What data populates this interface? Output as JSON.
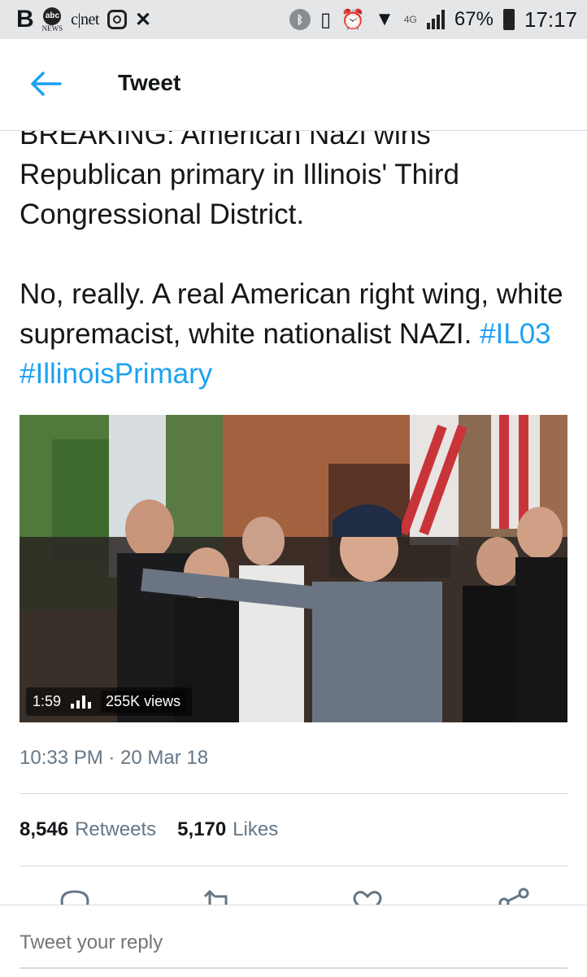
{
  "status_bar": {
    "left_icons": [
      "B",
      "abc",
      "NEWS",
      "c|net"
    ],
    "network": "4G",
    "battery_percent": "67%",
    "time": "17:17"
  },
  "header": {
    "title": "Tweet"
  },
  "tweet": {
    "line1": "BREAKING: American Nazi wins Republican primary in Illinois' Third Congressional District.",
    "line2": "No, really. A real American right wing, white supremacist, white nationalist NAZI.",
    "hashtag1": "#IL03",
    "hashtag2": "#IllinoisPrimary",
    "video": {
      "duration": "1:59",
      "views": "255K views"
    },
    "timestamp": "10:33 PM · 20 Mar 18",
    "retweets_count": "8,546",
    "retweets_label": "Retweets",
    "likes_count": "5,170",
    "likes_label": "Likes"
  },
  "reply": {
    "placeholder": "Tweet your reply"
  },
  "colors": {
    "accent": "#1da1f2",
    "secondary_text": "#657786"
  }
}
